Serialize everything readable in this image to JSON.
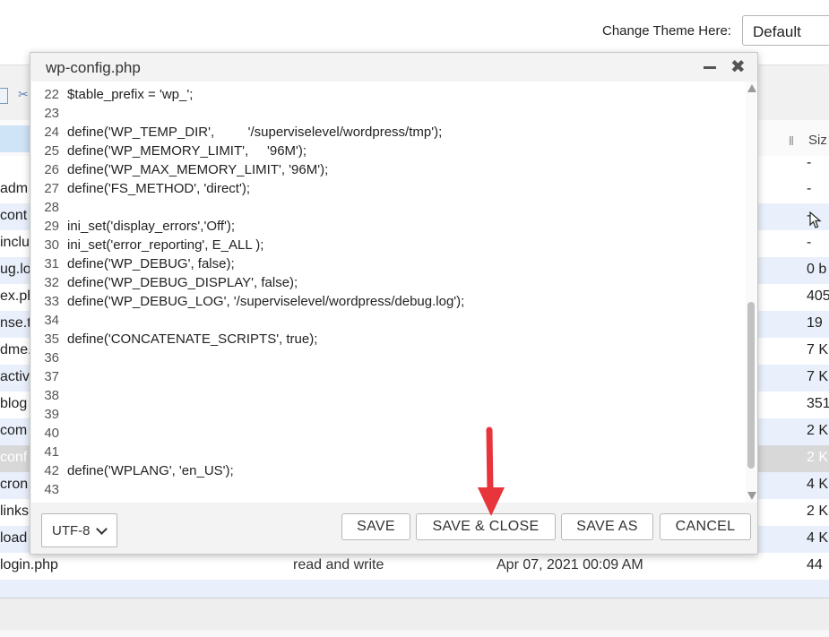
{
  "header": {
    "theme_label": "Change Theme Here:",
    "theme_value": "Default"
  },
  "file_list": {
    "size_header": "Siz",
    "rows": [
      {
        "name": "",
        "perm": "",
        "date": "",
        "size": "-"
      },
      {
        "name": "adm",
        "perm": "",
        "date": "",
        "size": "-"
      },
      {
        "name": "cont",
        "perm": "",
        "date": "",
        "size": "-"
      },
      {
        "name": "inclu",
        "perm": "",
        "date": "",
        "size": "-"
      },
      {
        "name": "ug.lo",
        "perm": "",
        "date": "",
        "size": "0 b"
      },
      {
        "name": "ex.ph",
        "perm": "",
        "date": "",
        "size": "405"
      },
      {
        "name": "nse.t",
        "perm": "",
        "date": "",
        "size": "19"
      },
      {
        "name": "dme.",
        "perm": "",
        "date": "",
        "size": "7 K"
      },
      {
        "name": "activ",
        "perm": "",
        "date": "",
        "size": "7 K"
      },
      {
        "name": "blog",
        "perm": "",
        "date": "",
        "size": "351"
      },
      {
        "name": "com",
        "perm": "",
        "date": "",
        "size": "2 K"
      },
      {
        "name": "conf",
        "perm": "",
        "date": "",
        "size": "2 K"
      },
      {
        "name": "cron",
        "perm": "",
        "date": "",
        "size": "4 K"
      },
      {
        "name": "links",
        "perm": "",
        "date": "",
        "size": "2 K"
      },
      {
        "name": "load",
        "perm": "",
        "date": "",
        "size": "4 K"
      },
      {
        "name": "login.php",
        "perm": "read and write",
        "date": "Apr 07, 2021 00:09 AM",
        "size": "44"
      }
    ]
  },
  "editor": {
    "title": "wp-config.php",
    "lines": [
      {
        "n": "22",
        "code": "$table_prefix = 'wp_';"
      },
      {
        "n": "23",
        "code": ""
      },
      {
        "n": "24",
        "code": "define('WP_TEMP_DIR',         '/superviselevel/wordpress/tmp');"
      },
      {
        "n": "25",
        "code": "define('WP_MEMORY_LIMIT',     '96M');"
      },
      {
        "n": "26",
        "code": "define('WP_MAX_MEMORY_LIMIT', '96M');"
      },
      {
        "n": "27",
        "code": "define('FS_METHOD', 'direct');"
      },
      {
        "n": "28",
        "code": ""
      },
      {
        "n": "29",
        "code": "ini_set('display_errors','Off');"
      },
      {
        "n": "30",
        "code": "ini_set('error_reporting', E_ALL );"
      },
      {
        "n": "31",
        "code": "define('WP_DEBUG', false);"
      },
      {
        "n": "32",
        "code": "define('WP_DEBUG_DISPLAY', false);"
      },
      {
        "n": "33",
        "code": "define('WP_DEBUG_LOG', '/superviselevel/wordpress/debug.log');"
      },
      {
        "n": "34",
        "code": ""
      },
      {
        "n": "35",
        "code": "define('CONCATENATE_SCRIPTS', true);"
      },
      {
        "n": "36",
        "code": ""
      },
      {
        "n": "37",
        "code": ""
      },
      {
        "n": "38",
        "code": ""
      },
      {
        "n": "39",
        "code": ""
      },
      {
        "n": "40",
        "code": ""
      },
      {
        "n": "41",
        "code": ""
      },
      {
        "n": "42",
        "code": "define('WPLANG', 'en_US');"
      },
      {
        "n": "43",
        "code": ""
      }
    ],
    "encoding": "UTF-8",
    "buttons": {
      "save": "SAVE",
      "save_close": "SAVE & CLOSE",
      "save_as": "SAVE AS",
      "cancel": "CANCEL"
    }
  },
  "colors": {
    "arrow": "#e8343b",
    "row_alt": "#e9f0fb",
    "row_selected": "#d8d8d8"
  }
}
